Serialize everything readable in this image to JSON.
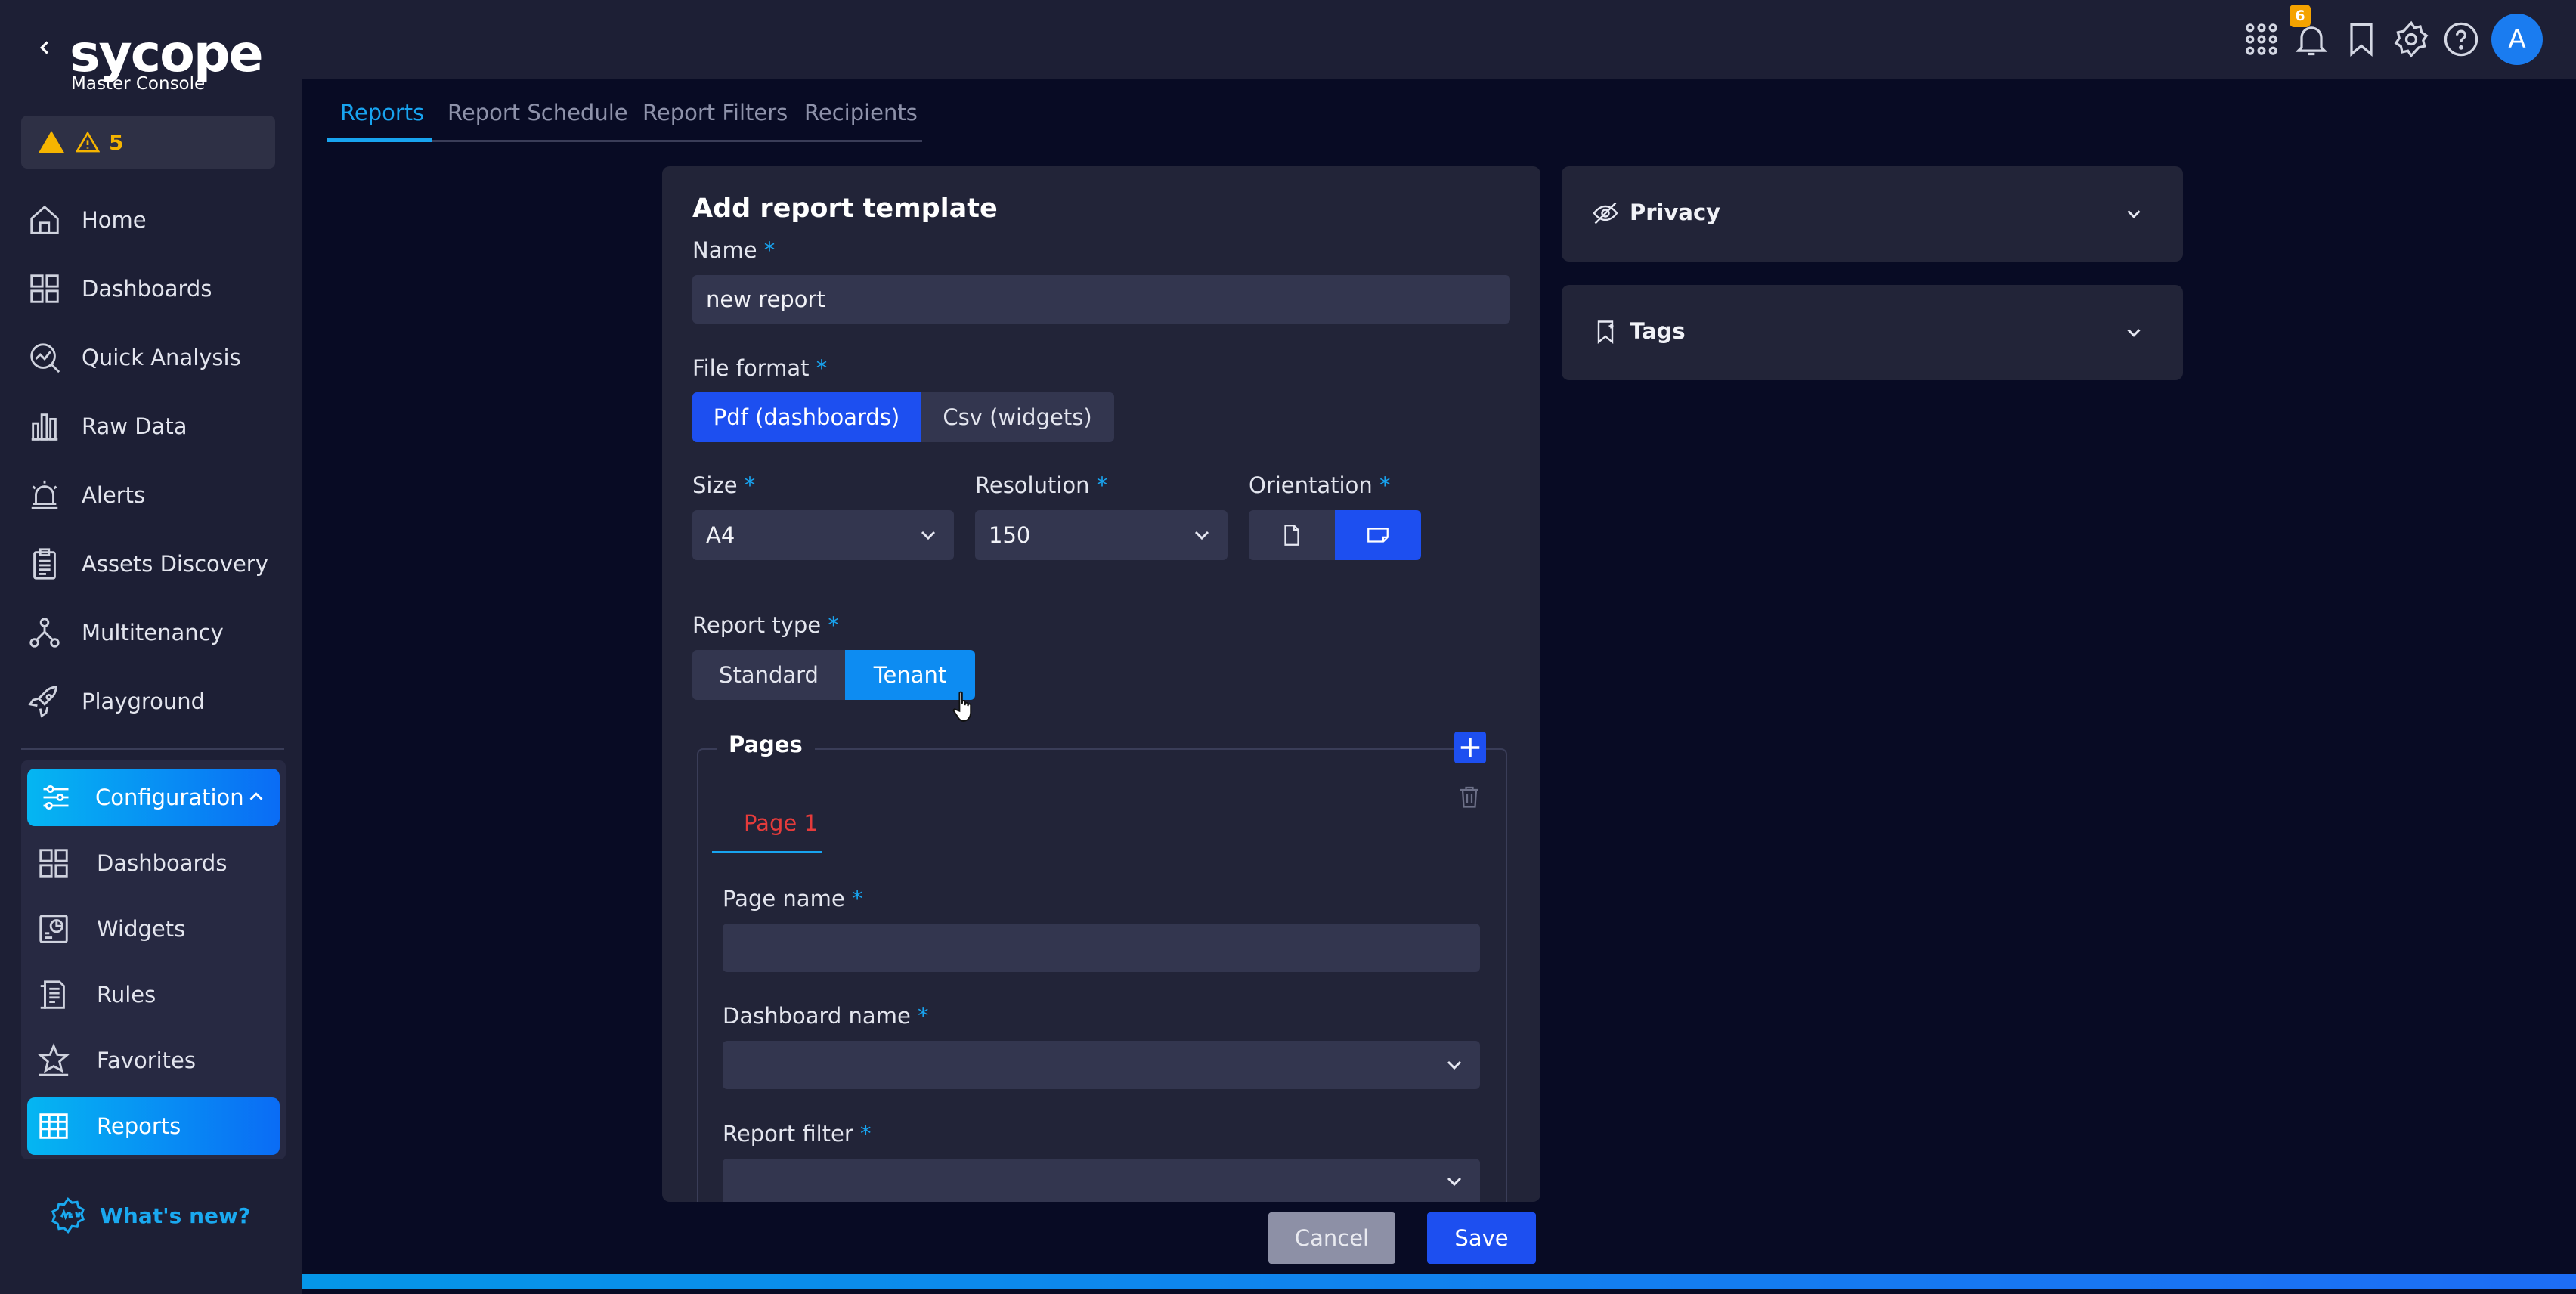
{
  "brand": {
    "logo": "sycope",
    "subtitle": "Master Console"
  },
  "alerts": {
    "count": "5"
  },
  "sidebar": {
    "items": [
      {
        "label": "Home",
        "icon": "home-icon"
      },
      {
        "label": "Dashboards",
        "icon": "dashboards-icon"
      },
      {
        "label": "Quick Analysis",
        "icon": "quick-analysis-icon"
      },
      {
        "label": "Raw Data",
        "icon": "raw-data-icon"
      },
      {
        "label": "Alerts",
        "icon": "siren-icon"
      },
      {
        "label": "Assets Discovery",
        "icon": "clipboard-icon"
      },
      {
        "label": "Multitenancy",
        "icon": "multitenancy-icon"
      },
      {
        "label": "Playground",
        "icon": "rocket-icon"
      }
    ],
    "configuration": {
      "label": "Configuration",
      "items": [
        {
          "label": "Dashboards"
        },
        {
          "label": "Widgets"
        },
        {
          "label": "Rules"
        },
        {
          "label": "Favorites"
        },
        {
          "label": "Reports"
        }
      ]
    },
    "whats_new": "What's new?"
  },
  "topbar": {
    "notification_count": "6",
    "avatar_letter": "A"
  },
  "tabs": [
    "Reports",
    "Report Schedule",
    "Report Filters",
    "Recipients"
  ],
  "form": {
    "title": "Add report template",
    "name_label": "Name",
    "name_value": "new report",
    "file_format_label": "File format",
    "file_format_options": [
      "Pdf (dashboards)",
      "Csv (widgets)"
    ],
    "file_format_selected": "Pdf (dashboards)",
    "size_label": "Size",
    "size_value": "A4",
    "resolution_label": "Resolution",
    "resolution_value": "150",
    "orientation_label": "Orientation",
    "orientation_selected": "landscape",
    "report_type_label": "Report type",
    "report_type_options": [
      "Standard",
      "Tenant"
    ],
    "report_type_selected": "Tenant",
    "pages_label": "Pages",
    "page_tab": "Page 1",
    "page_name_label": "Page name",
    "page_name_value": "",
    "dashboard_name_label": "Dashboard name",
    "report_filter_label": "Report filter",
    "required_mark": "*"
  },
  "buttons": {
    "cancel": "Cancel",
    "save": "Save"
  },
  "panels": {
    "privacy": "Privacy",
    "tags": "Tags"
  },
  "colors": {
    "accent": "#18a4f0",
    "primary": "#1d4ff0",
    "warning": "#f5b400",
    "page_tab": "#e53b3b"
  }
}
